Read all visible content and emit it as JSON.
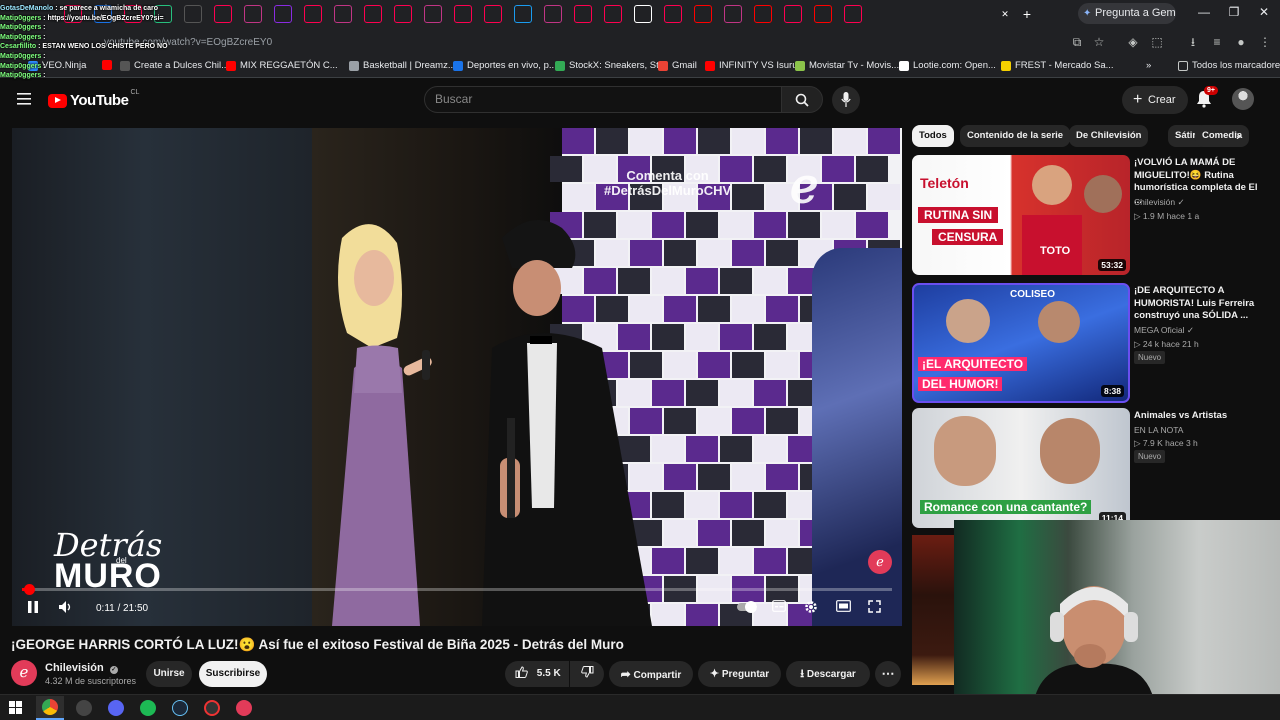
{
  "browser": {
    "address_url": "youtube.com/watch?v=EOgBZcreEY0",
    "gemini_label": "Pregunta a Gemini",
    "bookmarks": [
      {
        "label": "VEO.Ninja",
        "color": "#2d8cff"
      },
      {
        "label": "",
        "color": "#ff0000"
      },
      {
        "label": "Create a Dulces Chil...",
        "color": "#555555"
      },
      {
        "label": "MIX REGGAETÓN C...",
        "color": "#ff0000"
      },
      {
        "label": "Basketball | Dreamz...",
        "color": "#9aa0a6"
      },
      {
        "label": "Deportes en vivo, p...",
        "color": "#1a73e8"
      },
      {
        "label": "StockX: Sneakers, St...",
        "color": "#33aa55"
      },
      {
        "label": "Gmail",
        "color": "#ea4335"
      },
      {
        "label": "INFINITY VS Isurus",
        "color": "#ff0000"
      },
      {
        "label": "Movistar Tv - Movis...",
        "color": "#8bc34a"
      },
      {
        "label": "Lootie.com: Open...",
        "color": "#ffffff"
      },
      {
        "label": "FREST - Mercado Sa...",
        "color": "#f5d000"
      }
    ],
    "bookmarks_overflow": "»",
    "all_bookmarks": "Todos los marcadores"
  },
  "chat": [
    {
      "name": "GotasDeManolo",
      "text": "se parece a wiamicha de caro"
    },
    {
      "name": "Matip0ggers",
      "text": "https://youtu.be/EOgBZcreEY0?si="
    },
    {
      "name": "Matip0ggers",
      "text": ""
    },
    {
      "name": "Matip0ggers",
      "text": ""
    },
    {
      "name": "Cesarfillito",
      "text": "ESTAN WENO LOS CHISTE PERO NO"
    },
    {
      "name": "Matip0ggers",
      "text": ""
    },
    {
      "name": "Matip0ggers",
      "text": ""
    },
    {
      "name": "Matip0ggers",
      "text": ""
    }
  ],
  "youtube": {
    "logo": "YouTube",
    "country": "CL",
    "search_placeholder": "Buscar",
    "create_label": "Crear",
    "notif_count": "9+"
  },
  "video": {
    "watermark_line1": "Comenta con",
    "watermark_line2": "#DetrásDelMuroCHV",
    "show_logo_line1": "Detrás",
    "show_logo_small": "del",
    "show_logo_line2": "MURO",
    "time_current": "0:11",
    "time_total": "21:50",
    "time_display": "0:11 / 21:50",
    "progress_fraction": 0.0084
  },
  "meta": {
    "title": "¡GEORGE HARRIS CORTÓ LA LUZ!😮 Así fue el exitoso Festival de Biña 2025 - Detrás del Muro",
    "channel": "Chilevisión",
    "subscribers": "4.32 M de suscriptores",
    "join": "Unirse",
    "subscribe": "Suscribirse",
    "likes": "5.5 K",
    "share": "Compartir",
    "ask": "Preguntar",
    "download": "Descargar"
  },
  "sidebar": {
    "chips": [
      "Todos",
      "Contenido de la serie",
      "De Chilevisión",
      "Sátira",
      "Comedia"
    ],
    "recommendations": [
      {
        "title": "¡VOLVIÓ LA MAMÁ DE MIGUELITO!😆 Rutina humorística completa de El ...",
        "channel": "Chilevisión",
        "views": "1.9 M",
        "age": "hace 1 a",
        "duration": "53:32",
        "badge": "",
        "thumb_text1": "Teletón",
        "thumb_text2": "RUTINA SIN",
        "thumb_text3": "CENSURA",
        "thumb_text4": "TOTO"
      },
      {
        "title": "¡DE ARQUITECTO A HUMORISTA! Luis Ferreira construyó una SÓLIDA ...",
        "channel": "MEGA Oficial",
        "views": "24 k",
        "age": "hace 21 h",
        "duration": "8:38",
        "badge": "Nuevo",
        "thumb_text1": "COLISEO",
        "thumb_text2": "¡EL ARQUITECTO",
        "thumb_text3": "DEL HUMOR!",
        "thumb_text4": ""
      },
      {
        "title": "Animales vs Artistas",
        "channel": "EN LA NOTA",
        "views": "7.9 K",
        "age": "hace 3 h",
        "duration": "11:14",
        "badge": "Nuevo",
        "thumb_text1": "Romance con una cantante?",
        "thumb_text2": "",
        "thumb_text3": "",
        "thumb_text4": ""
      }
    ]
  },
  "colors": {
    "youtube_red": "#ff0000",
    "chilevision_pink": "#e23b59",
    "binia_purple": "#5b2a8e",
    "background": "#0f0f0f"
  }
}
